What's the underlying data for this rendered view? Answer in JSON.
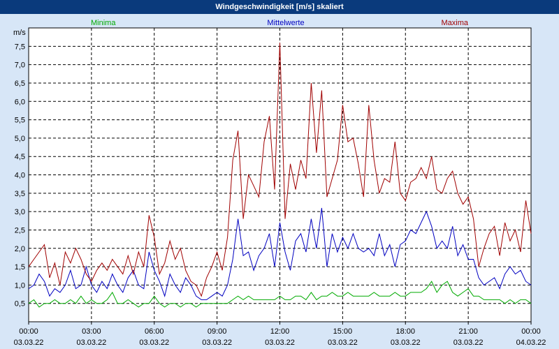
{
  "window": {
    "title": "Windgeschwindigkeit [m/s] skaliert"
  },
  "colors": {
    "minima": "#00aa00",
    "mittel": "#0000c0",
    "maxima": "#a00000",
    "background": "#d7e6f7",
    "title_bar": "#0a3a7c"
  },
  "chart_data": {
    "type": "line",
    "title": "Windgeschwindigkeit [m/s] skaliert",
    "ylabel": "m/s",
    "xlabel": "",
    "ylim": [
      0,
      8
    ],
    "xlim": [
      0,
      24
    ],
    "grid": true,
    "legend_placement": "top",
    "y_ticks": [
      "0,5",
      "1,0",
      "1,5",
      "2,0",
      "2,5",
      "3,0",
      "3,5",
      "4,0",
      "4,5",
      "5,0",
      "5,5",
      "6,0",
      "6,5",
      "7,0",
      "7,5"
    ],
    "y_tick_values": [
      0.5,
      1.0,
      1.5,
      2.0,
      2.5,
      3.0,
      3.5,
      4.0,
      4.5,
      5.0,
      5.5,
      6.0,
      6.5,
      7.0,
      7.5
    ],
    "x_ticks": [
      {
        "hours": 0,
        "time": "00:00",
        "date": "03.03.22"
      },
      {
        "hours": 3,
        "time": "03:00",
        "date": "03.03.22"
      },
      {
        "hours": 6,
        "time": "06:00",
        "date": "03.03.22"
      },
      {
        "hours": 9,
        "time": "09:00",
        "date": "03.03.22"
      },
      {
        "hours": 12,
        "time": "12:00",
        "date": "03.03.22"
      },
      {
        "hours": 15,
        "time": "15:00",
        "date": "03.03.22"
      },
      {
        "hours": 18,
        "time": "18:00",
        "date": "03.03.22"
      },
      {
        "hours": 21,
        "time": "21:00",
        "date": "03.03.22"
      },
      {
        "hours": 24,
        "time": "00:00",
        "date": "04.03.22"
      }
    ],
    "series": [
      {
        "name": "Minima",
        "color": "#00aa00",
        "x": [
          0,
          0.25,
          0.5,
          0.75,
          1,
          1.25,
          1.5,
          1.75,
          2,
          2.25,
          2.5,
          2.75,
          3,
          3.25,
          3.5,
          3.75,
          4,
          4.25,
          4.5,
          4.75,
          5,
          5.25,
          5.5,
          5.75,
          6,
          6.25,
          6.5,
          6.75,
          7,
          7.25,
          7.5,
          7.75,
          8,
          8.25,
          8.5,
          8.75,
          9,
          9.25,
          9.5,
          9.75,
          10,
          10.25,
          10.5,
          10.75,
          11,
          11.25,
          11.5,
          11.75,
          12,
          12.25,
          12.5,
          12.75,
          13,
          13.25,
          13.5,
          13.75,
          14,
          14.25,
          14.5,
          14.75,
          15,
          15.25,
          15.5,
          15.75,
          16,
          16.25,
          16.5,
          16.75,
          17,
          17.25,
          17.5,
          17.75,
          18,
          18.25,
          18.5,
          18.75,
          19,
          19.25,
          19.5,
          19.75,
          20,
          20.25,
          20.5,
          20.75,
          21,
          21.25,
          21.5,
          21.75,
          22,
          22.25,
          22.5,
          22.75,
          23,
          23.25,
          23.5,
          23.75,
          24
        ],
        "values": [
          0.5,
          0.6,
          0.4,
          0.5,
          0.5,
          0.6,
          0.5,
          0.5,
          0.6,
          0.5,
          0.7,
          0.5,
          0.6,
          0.5,
          0.5,
          0.6,
          0.8,
          0.5,
          0.5,
          0.6,
          0.5,
          0.4,
          0.5,
          0.5,
          0.7,
          0.5,
          0.4,
          0.5,
          0.5,
          0.4,
          0.5,
          0.5,
          0.4,
          0.5,
          0.5,
          0.5,
          0.5,
          0.5,
          0.5,
          0.6,
          0.7,
          0.6,
          0.7,
          0.6,
          0.6,
          0.6,
          0.6,
          0.6,
          0.7,
          0.6,
          0.6,
          0.7,
          0.7,
          0.6,
          0.8,
          0.6,
          0.7,
          0.7,
          0.8,
          0.7,
          0.7,
          0.8,
          0.7,
          0.7,
          0.7,
          0.7,
          0.8,
          0.7,
          0.7,
          0.7,
          0.8,
          0.7,
          0.7,
          0.8,
          0.8,
          0.8,
          0.9,
          1.1,
          0.8,
          1.0,
          1.1,
          0.8,
          0.7,
          0.8,
          0.9,
          0.7,
          0.7,
          0.6,
          0.6,
          0.6,
          0.6,
          0.5,
          0.6,
          0.5,
          0.6,
          0.6,
          0.5
        ]
      },
      {
        "name": "Mittelwerte",
        "color": "#0000c0",
        "x": [
          0,
          0.25,
          0.5,
          0.75,
          1,
          1.25,
          1.5,
          1.75,
          2,
          2.25,
          2.5,
          2.75,
          3,
          3.25,
          3.5,
          3.75,
          4,
          4.25,
          4.5,
          4.75,
          5,
          5.25,
          5.5,
          5.75,
          6,
          6.25,
          6.5,
          6.75,
          7,
          7.25,
          7.5,
          7.75,
          8,
          8.25,
          8.5,
          8.75,
          9,
          9.25,
          9.5,
          9.75,
          10,
          10.25,
          10.5,
          10.75,
          11,
          11.25,
          11.5,
          11.75,
          12,
          12.25,
          12.5,
          12.75,
          13,
          13.25,
          13.5,
          13.75,
          14,
          14.25,
          14.5,
          14.75,
          15,
          15.25,
          15.5,
          15.75,
          16,
          16.25,
          16.5,
          16.75,
          17,
          17.25,
          17.5,
          17.75,
          18,
          18.25,
          18.5,
          18.75,
          19,
          19.25,
          19.5,
          19.75,
          20,
          20.25,
          20.5,
          20.75,
          21,
          21.25,
          21.5,
          21.75,
          22,
          22.25,
          22.5,
          22.75,
          23,
          23.25,
          23.5,
          23.75,
          24
        ],
        "values": [
          0.9,
          1.0,
          1.3,
          1.1,
          0.7,
          0.9,
          0.8,
          1.0,
          1.4,
          0.9,
          1.0,
          1.5,
          1.0,
          0.8,
          1.1,
          0.9,
          1.3,
          1.0,
          0.8,
          1.2,
          1.4,
          1.0,
          0.9,
          1.9,
          1.4,
          1.1,
          0.7,
          1.3,
          1.0,
          0.8,
          1.2,
          1.0,
          0.7,
          0.6,
          0.6,
          0.7,
          0.8,
          0.7,
          1.0,
          1.7,
          2.8,
          1.8,
          1.9,
          1.4,
          1.8,
          2.0,
          2.4,
          1.5,
          2.7,
          1.9,
          1.4,
          2.2,
          2.4,
          1.9,
          2.8,
          2.0,
          3.1,
          1.5,
          2.4,
          1.9,
          2.3,
          2.0,
          2.4,
          2.0,
          1.9,
          2.0,
          1.8,
          2.4,
          1.8,
          2.1,
          1.5,
          2.1,
          2.2,
          2.5,
          2.4,
          2.7,
          3.0,
          2.6,
          2.0,
          2.2,
          2.0,
          2.6,
          1.8,
          2.1,
          1.7,
          1.7,
          1.2,
          1.0,
          1.1,
          1.2,
          0.9,
          1.3,
          1.5,
          1.3,
          1.4,
          1.1,
          1.0
        ]
      },
      {
        "name": "Maxima",
        "color": "#a00000",
        "x": [
          0,
          0.25,
          0.5,
          0.75,
          1,
          1.25,
          1.5,
          1.75,
          2,
          2.25,
          2.5,
          2.75,
          3,
          3.25,
          3.5,
          3.75,
          4,
          4.25,
          4.5,
          4.75,
          5,
          5.25,
          5.5,
          5.75,
          6,
          6.25,
          6.5,
          6.75,
          7,
          7.25,
          7.5,
          7.75,
          8,
          8.25,
          8.5,
          8.75,
          9,
          9.25,
          9.5,
          9.75,
          10,
          10.25,
          10.5,
          10.75,
          11,
          11.25,
          11.5,
          11.75,
          12,
          12.25,
          12.5,
          12.75,
          13,
          13.25,
          13.5,
          13.75,
          14,
          14.25,
          14.5,
          14.75,
          15,
          15.25,
          15.5,
          15.75,
          16,
          16.25,
          16.5,
          16.75,
          17,
          17.25,
          17.5,
          17.75,
          18,
          18.25,
          18.5,
          18.75,
          19,
          19.25,
          19.5,
          19.75,
          20,
          20.25,
          20.5,
          20.75,
          21,
          21.25,
          21.5,
          21.75,
          22,
          22.25,
          22.5,
          22.75,
          23,
          23.25,
          23.5,
          23.75,
          24
        ],
        "values": [
          1.5,
          1.7,
          1.9,
          2.1,
          1.2,
          1.6,
          1.0,
          1.9,
          1.6,
          2.0,
          1.7,
          1.3,
          1.1,
          1.4,
          1.6,
          1.4,
          1.7,
          1.5,
          1.3,
          1.8,
          1.3,
          1.9,
          1.5,
          2.9,
          2.3,
          1.3,
          1.6,
          2.2,
          1.7,
          2.0,
          1.4,
          1.1,
          1.0,
          0.7,
          1.2,
          1.5,
          1.9,
          1.4,
          2.3,
          4.4,
          5.2,
          2.8,
          4.0,
          3.7,
          3.4,
          4.9,
          5.6,
          3.6,
          7.6,
          2.8,
          4.3,
          3.6,
          4.4,
          3.9,
          6.5,
          4.6,
          6.3,
          3.4,
          3.9,
          4.4,
          5.9,
          4.9,
          5.0,
          4.3,
          3.4,
          5.9,
          4.4,
          3.5,
          3.9,
          3.8,
          4.9,
          3.5,
          3.3,
          3.8,
          3.9,
          4.2,
          3.9,
          4.5,
          3.6,
          3.5,
          3.9,
          4.1,
          3.5,
          3.2,
          3.4,
          2.8,
          1.5,
          2.0,
          2.4,
          2.6,
          1.8,
          2.7,
          2.2,
          2.5,
          1.9,
          3.3,
          2.4
        ]
      }
    ]
  }
}
